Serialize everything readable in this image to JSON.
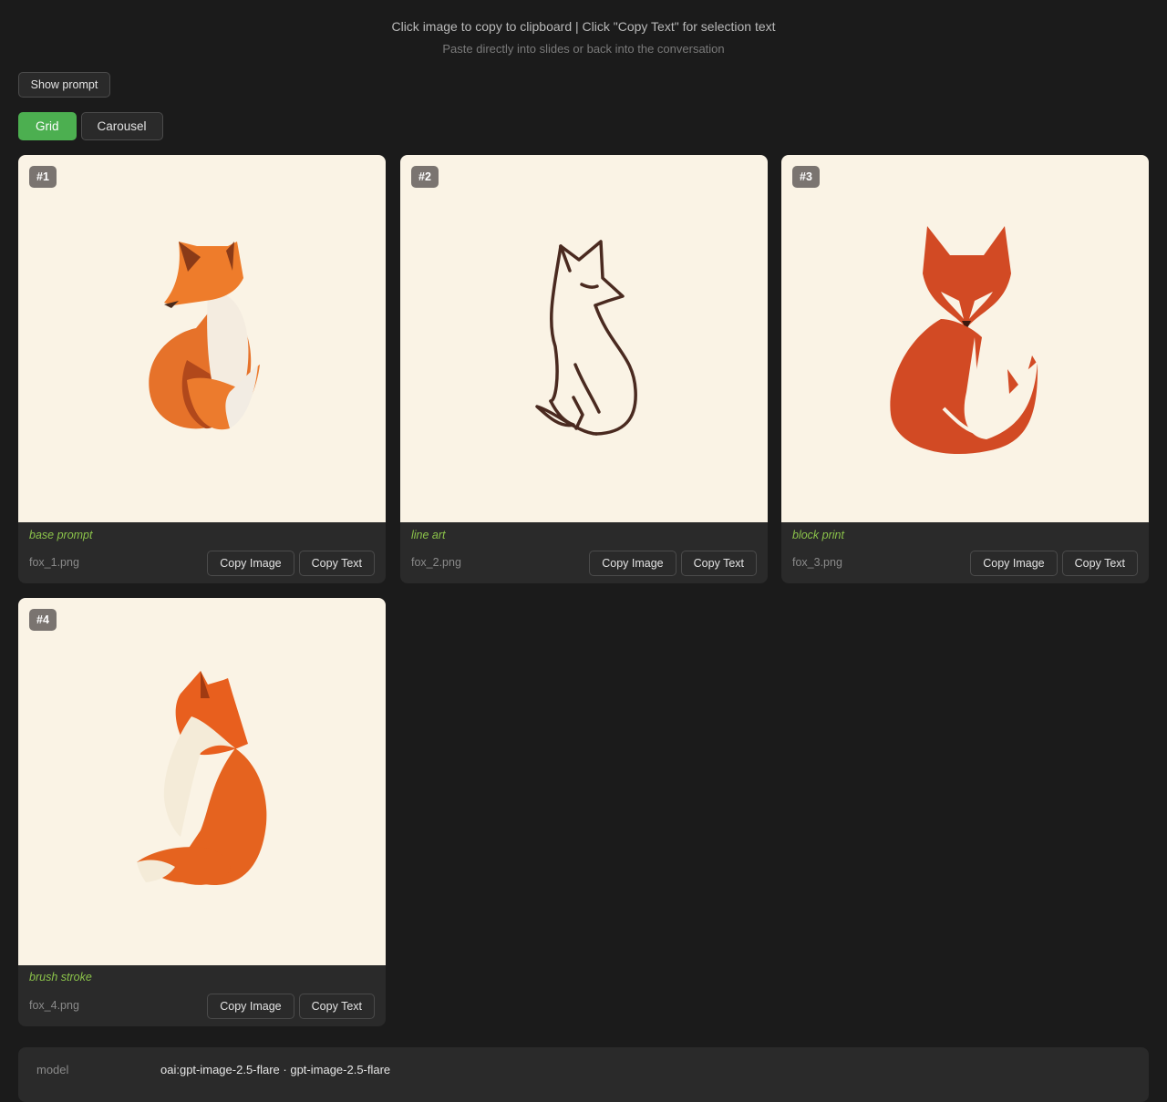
{
  "header": {
    "instruction": "Click image to copy to clipboard | Click \"Copy Text\" for selection text",
    "subtitle": "Paste directly into slides or back into the conversation"
  },
  "controls": {
    "show_prompt_label": "Show prompt",
    "view_modes": [
      {
        "label": "Grid",
        "active": true
      },
      {
        "label": "Carousel",
        "active": false
      }
    ]
  },
  "cards": [
    {
      "badge": "#1",
      "caption": "base prompt",
      "filename": "fox_1.png",
      "image_desc": "fox-paper-cut-illustration",
      "copy_image_label": "Copy Image",
      "copy_text_label": "Copy Text"
    },
    {
      "badge": "#2",
      "caption": "line art",
      "filename": "fox_2.png",
      "image_desc": "fox-line-art-illustration",
      "copy_image_label": "Copy Image",
      "copy_text_label": "Copy Text"
    },
    {
      "badge": "#3",
      "caption": "block print",
      "filename": "fox_3.png",
      "image_desc": "fox-block-print-illustration",
      "copy_image_label": "Copy Image",
      "copy_text_label": "Copy Text"
    },
    {
      "badge": "#4",
      "caption": "brush stroke",
      "filename": "fox_4.png",
      "image_desc": "fox-brush-stroke-illustration",
      "copy_image_label": "Copy Image",
      "copy_text_label": "Copy Text"
    }
  ],
  "metadata": {
    "model_key": "model",
    "model_value": "oai:gpt-image-2.5-flare · gpt-image-2.5-flare"
  },
  "colors": {
    "background": "#1b1b1b",
    "card": "#2a2a2a",
    "accent_green": "#4caf50",
    "caption_green": "#8bc34a",
    "image_bg": "#faf3e5"
  }
}
